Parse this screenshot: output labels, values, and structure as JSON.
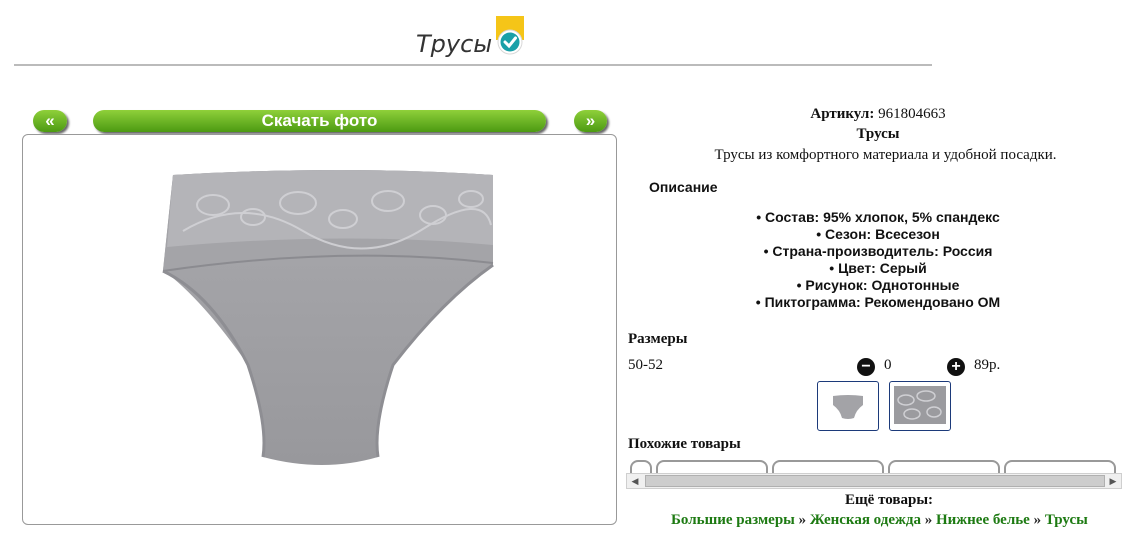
{
  "page": {
    "title": "Трусы",
    "badge_icon": "verified-check-icon"
  },
  "gallery": {
    "prev_label": "«",
    "download_label": "Скачать фото",
    "next_label": "»"
  },
  "product": {
    "article_label": "Артикул:",
    "article_value": "961804663",
    "name": "Трусы",
    "short_desc": "Трусы из комфортного материала и удобной посадки.",
    "description_heading": "Описание",
    "properties": [
      "Состав: 95% хлопок, 5% спандекс",
      "Сезон: Всесезон",
      "Страна-производитель: Россия",
      "Цвет: Серый",
      "Рисунок: Однотонные",
      "Пиктограмма: Рекомендовано ОМ"
    ]
  },
  "sizes": {
    "heading": "Размеры",
    "rows": [
      {
        "size": "50-52",
        "qty": "0",
        "price": "89р."
      }
    ],
    "minus_icon": "minus-circle-icon",
    "plus_icon": "plus-circle-icon"
  },
  "similar": {
    "heading": "Похожие товары"
  },
  "more": {
    "heading": "Ещё товары:",
    "crumbs": [
      "Большие размеры",
      "Женская одежда",
      "Нижнее белье",
      "Трусы"
    ],
    "separator": "»"
  }
}
